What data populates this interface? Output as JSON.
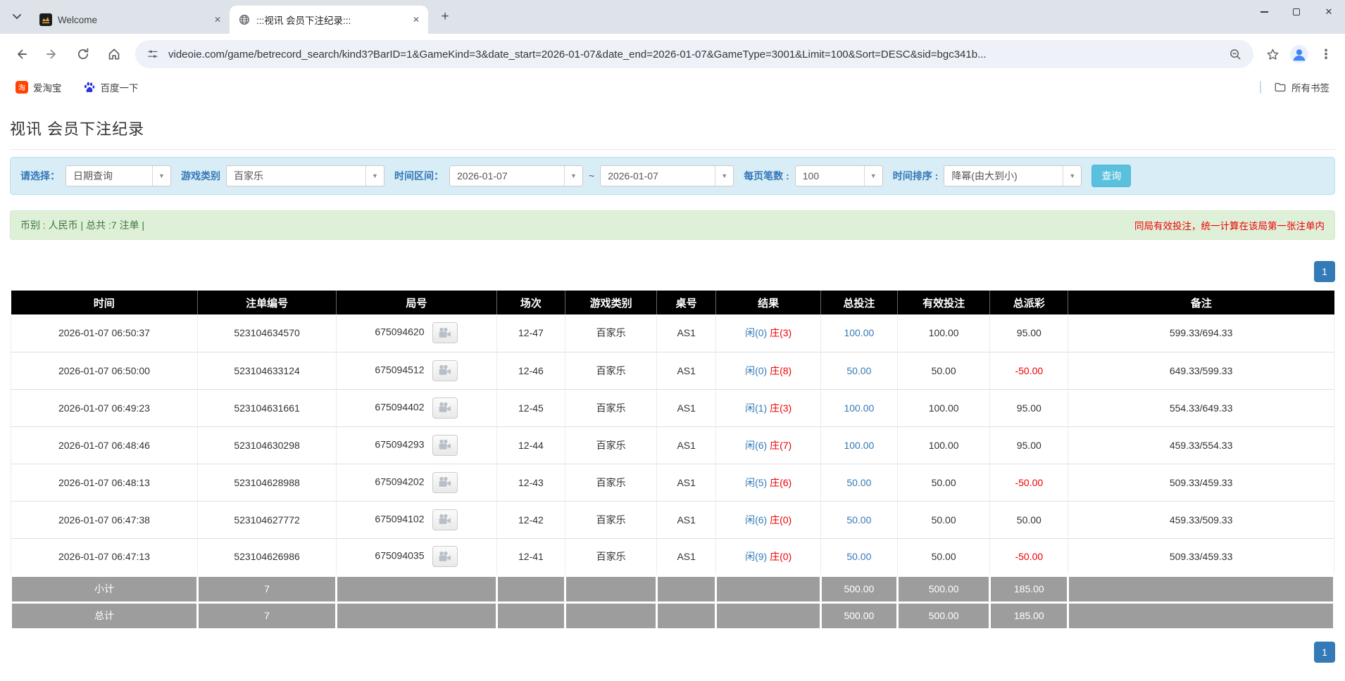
{
  "colors": {
    "link_blue": "#337ab7",
    "danger_red": "#ee0000",
    "header_bg": "#000000",
    "footer_bg": "#9d9d9d",
    "panel_bg": "#d9edf7",
    "info_bg": "#dff0d8",
    "btn_cyan": "#5bc0de",
    "badge_blue": "#337ab7"
  },
  "icons": {
    "close": "✕",
    "plus": "+",
    "select_arrow": "▼",
    "kebab": "⋮"
  },
  "browser": {
    "tabs": [
      {
        "title": "Welcome"
      },
      {
        "title": ":::视讯 会员下注纪录:::"
      }
    ],
    "url": "videoie.com/game/betrecord_search/kind3?BarID=1&GameKind=3&date_start=2026-01-07&date_end=2026-01-07&GameType=3001&Limit=100&Sort=DESC&sid=bgc341b...",
    "bookmarks": [
      {
        "label": "爱淘宝"
      },
      {
        "label": "百度一下"
      }
    ],
    "all_bookmarks_label": "所有书签"
  },
  "page": {
    "title": "视讯 会员下注纪录",
    "filter": {
      "select_label": "请选择：",
      "select_value": "日期查询",
      "game_kind_label": "游戏类别",
      "game_kind_value": "百家乐",
      "date_range_label": "时间区间：",
      "date_start": "2026-01-07",
      "tilde": "~",
      "date_end": "2026-01-07",
      "page_size_label": "每页笔数 :",
      "page_size_value": "100",
      "sort_label": "时间排序 :",
      "sort_value": "降幂(由大到小)",
      "search_button": "查询"
    },
    "info_bar": {
      "left": "币别 : 人民币 | 总共 :7 注单 |",
      "right": "同局有效投注，统一计算在该局第一张注单内"
    },
    "pagination": "1",
    "table": {
      "headers": [
        "时间",
        "注单编号",
        "局号",
        "场次",
        "游戏类别",
        "桌号",
        "结果",
        "总投注",
        "有效投注",
        "总派彩",
        "备注"
      ],
      "rows": [
        {
          "time": "2026-01-07 06:50:37",
          "bet_id": "523104634570",
          "round": "675094620",
          "session": "12-47",
          "game": "百家乐",
          "table_no": "AS1",
          "result_player": "闲(0)",
          "result_banker": "庄(3)",
          "total_bet": "100.00",
          "valid_bet": "100.00",
          "payout": "95.00",
          "remark": "599.33/694.33"
        },
        {
          "time": "2026-01-07 06:50:00",
          "bet_id": "523104633124",
          "round": "675094512",
          "session": "12-46",
          "game": "百家乐",
          "table_no": "AS1",
          "result_player": "闲(0)",
          "result_banker": "庄(8)",
          "total_bet": "50.00",
          "valid_bet": "50.00",
          "payout": "-50.00",
          "remark": "649.33/599.33"
        },
        {
          "time": "2026-01-07 06:49:23",
          "bet_id": "523104631661",
          "round": "675094402",
          "session": "12-45",
          "game": "百家乐",
          "table_no": "AS1",
          "result_player": "闲(1)",
          "result_banker": "庄(3)",
          "total_bet": "100.00",
          "valid_bet": "100.00",
          "payout": "95.00",
          "remark": "554.33/649.33"
        },
        {
          "time": "2026-01-07 06:48:46",
          "bet_id": "523104630298",
          "round": "675094293",
          "session": "12-44",
          "game": "百家乐",
          "table_no": "AS1",
          "result_player": "闲(6)",
          "result_banker": "庄(7)",
          "total_bet": "100.00",
          "valid_bet": "100.00",
          "payout": "95.00",
          "remark": "459.33/554.33"
        },
        {
          "time": "2026-01-07 06:48:13",
          "bet_id": "523104628988",
          "round": "675094202",
          "session": "12-43",
          "game": "百家乐",
          "table_no": "AS1",
          "result_player": "闲(5)",
          "result_banker": "庄(6)",
          "total_bet": "50.00",
          "valid_bet": "50.00",
          "payout": "-50.00",
          "remark": "509.33/459.33"
        },
        {
          "time": "2026-01-07 06:47:38",
          "bet_id": "523104627772",
          "round": "675094102",
          "session": "12-42",
          "game": "百家乐",
          "table_no": "AS1",
          "result_player": "闲(6)",
          "result_banker": "庄(0)",
          "total_bet": "50.00",
          "valid_bet": "50.00",
          "payout": "50.00",
          "remark": "459.33/509.33"
        },
        {
          "time": "2026-01-07 06:47:13",
          "bet_id": "523104626986",
          "round": "675094035",
          "session": "12-41",
          "game": "百家乐",
          "table_no": "AS1",
          "result_player": "闲(9)",
          "result_banker": "庄(0)",
          "total_bet": "50.00",
          "valid_bet": "50.00",
          "payout": "-50.00",
          "remark": "509.33/459.33"
        }
      ],
      "subtotal": {
        "label": "小计",
        "count": "7",
        "total_bet": "500.00",
        "valid_bet": "500.00",
        "payout": "185.00"
      },
      "total": {
        "label": "总计",
        "count": "7",
        "total_bet": "500.00",
        "valid_bet": "500.00",
        "payout": "185.00"
      }
    }
  }
}
